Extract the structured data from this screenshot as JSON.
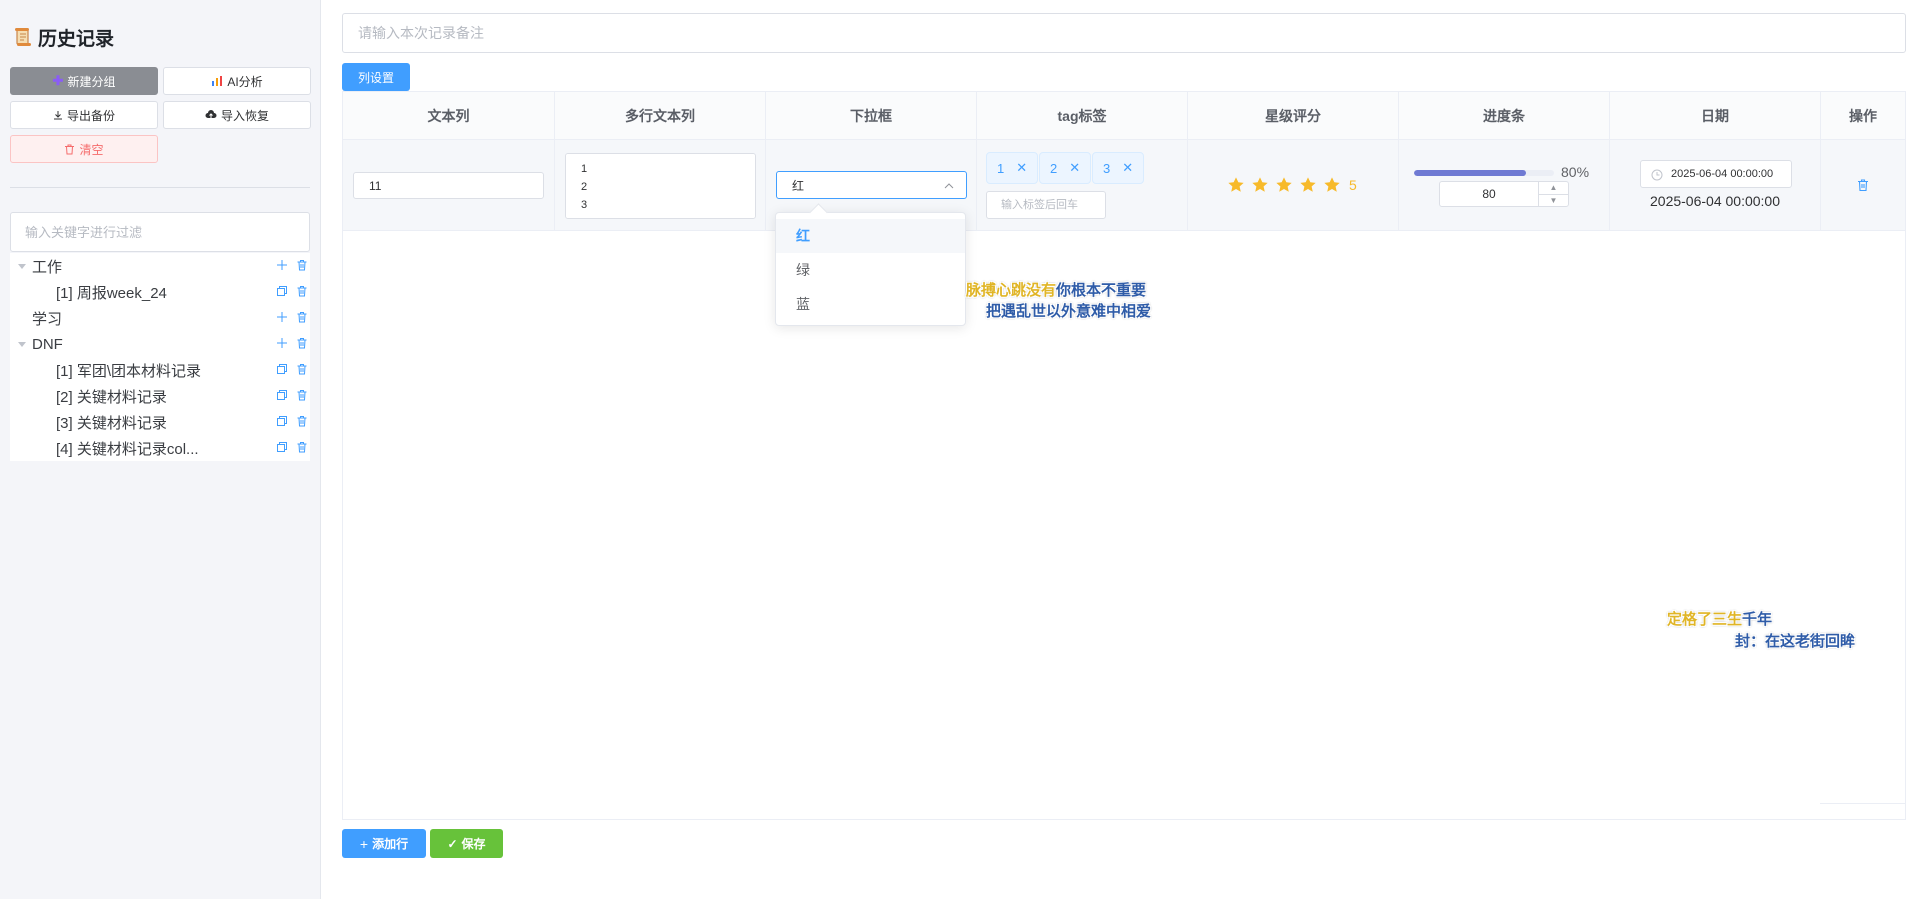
{
  "sidebar": {
    "title": "历史记录",
    "buttons": {
      "new_group": "新建分组",
      "ai_analysis": "AI分析",
      "export_backup": "导出备份",
      "import_restore": "导入恢复",
      "clear": "清空"
    },
    "filter_placeholder": "输入关键字进行过滤",
    "tree": [
      {
        "label": "工作",
        "children": [
          {
            "label": "[1] 周报week_24"
          }
        ]
      },
      {
        "label": "学习",
        "children": []
      },
      {
        "label": "DNF",
        "children": [
          {
            "label": "[1] 军团\\团本材料记录"
          },
          {
            "label": "[2] 关键材料记录"
          },
          {
            "label": "[3] 关键材料记录"
          },
          {
            "label": "[4] 关键材料记录col..."
          }
        ]
      }
    ]
  },
  "main": {
    "note_placeholder": "请输入本次记录备注",
    "column_settings": "列设置",
    "columns": [
      "文本列",
      "多行文本列",
      "下拉框",
      "tag标签",
      "星级评分",
      "进度条",
      "日期",
      "操作"
    ],
    "row": {
      "text": "11",
      "multiline": "1\n2\n3",
      "select": "红",
      "tags": [
        "1",
        "2",
        "3"
      ],
      "tag_input_placeholder": "输入标签后回车",
      "rating": 5,
      "rating_text": "5",
      "progress": 80,
      "progress_text": "80%",
      "progress_input": "80",
      "date_input": "2025-06-04 00:00:00",
      "date_text": "2025-06-04 00:00:00"
    },
    "dropdown_options": [
      "红",
      "绿",
      "蓝"
    ],
    "dropdown_selected": "红",
    "overlay_texts": {
      "line1_yellow": "脉搏心跳没有",
      "line1_blue": "你根本不重要",
      "line2": "把遇乱世以外意难中相爱",
      "line3_yellow": "定格了三生",
      "line3_blue": "千年",
      "line4": "封：在这老街回眸"
    },
    "footer": {
      "add_row": "添加行",
      "save": "保存"
    }
  },
  "colors": {
    "primary": "#409eff",
    "success": "#67c23a",
    "danger": "#f56c6c",
    "star": "#f7ba2a",
    "progress": "#6f7ad3"
  }
}
